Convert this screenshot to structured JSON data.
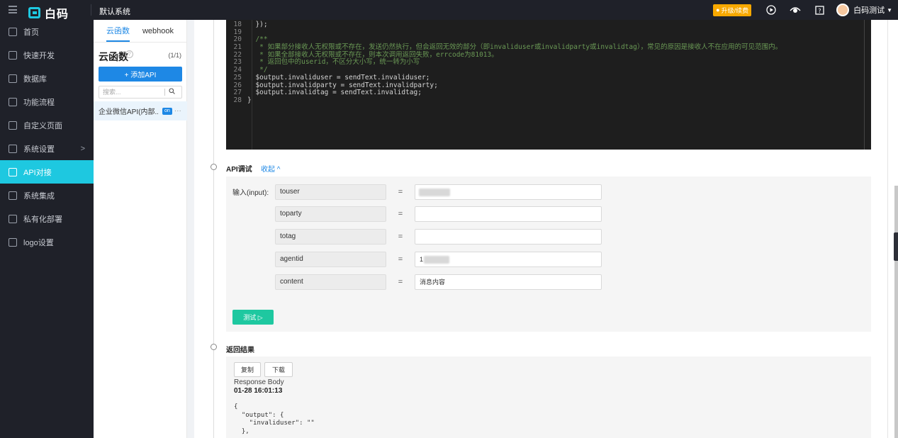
{
  "topbar": {
    "logo_text": "白码",
    "system_name": "默认系统",
    "upgrade_label": "升级/续费",
    "user_name": "白码测试"
  },
  "leftnav": {
    "items": [
      {
        "label": "首页",
        "icon": "home-icon"
      },
      {
        "label": "快速开发",
        "icon": "cube-icon"
      },
      {
        "label": "数据库",
        "icon": "database-icon"
      },
      {
        "label": "功能流程",
        "icon": "flow-icon"
      },
      {
        "label": "自定义页面",
        "icon": "page-icon"
      },
      {
        "label": "系统设置",
        "icon": "settings-icon",
        "chevron": ">"
      },
      {
        "label": "API对接",
        "icon": "api-icon",
        "active": true
      },
      {
        "label": "系统集成",
        "icon": "layers-icon"
      },
      {
        "label": "私有化部署",
        "icon": "server-icon"
      },
      {
        "label": "logo设置",
        "icon": "logo-icon"
      }
    ],
    "active_color": "#1ec8e0"
  },
  "column2": {
    "tabs": [
      "云函数",
      "webhook"
    ],
    "title": "云函数",
    "count": "(1/1)",
    "add_button": "+ 添加API",
    "search_placeholder": "搜索...",
    "api_item_name": "企业微信API(内部...",
    "api_item_badge": "on",
    "api_item_more": "···"
  },
  "code": {
    "lines": [
      {
        "n": "18",
        "t": "  });",
        "c": false
      },
      {
        "n": "19",
        "t": "",
        "c": false
      },
      {
        "n": "20",
        "t": "  /**",
        "c": true
      },
      {
        "n": "21",
        "t": "   * 如果部分接收人无权限或不存在，发送仍然执行，但会返回无效的部分（即invaliduser或invalidparty或invalidtag），常见的原因是接收人不在应用的可见范围内。",
        "c": true
      },
      {
        "n": "22",
        "t": "   * 如果全部接收人无权限或不存在，则本次调用返回失败，errcode为81013。",
        "c": true
      },
      {
        "n": "23",
        "t": "   * 返回包中的userid，不区分大小写，统一转为小写",
        "c": true
      },
      {
        "n": "24",
        "t": "   */",
        "c": true
      },
      {
        "n": "25",
        "t": "  $output.invaliduser = sendText.invaliduser;",
        "c": false
      },
      {
        "n": "26",
        "t": "  $output.invalidparty = sendText.invalidparty;",
        "c": false
      },
      {
        "n": "27",
        "t": "  $output.invalidtag = sendText.invalidtag;",
        "c": false
      },
      {
        "n": "28",
        "t": "}",
        "c": false
      }
    ]
  },
  "api_test": {
    "title": "API调试",
    "collapse_label": "收起 ^",
    "input_label": "输入(input):",
    "params": [
      {
        "name": "touser",
        "value": ""
      },
      {
        "name": "toparty",
        "value": ""
      },
      {
        "name": "totag",
        "value": ""
      },
      {
        "name": "agentid",
        "value": "1"
      },
      {
        "name": "content",
        "value": "消息内容"
      }
    ],
    "equals": "=",
    "test_button": "测试 ▷"
  },
  "result": {
    "title": "返回结果",
    "copy_label": "复制",
    "download_label": "下载",
    "response_label": "Response Body",
    "response_time": "01-28 16:01:13",
    "body": "{\n  \"output\": {\n    \"invaliduser\": \"\"\n  },"
  }
}
